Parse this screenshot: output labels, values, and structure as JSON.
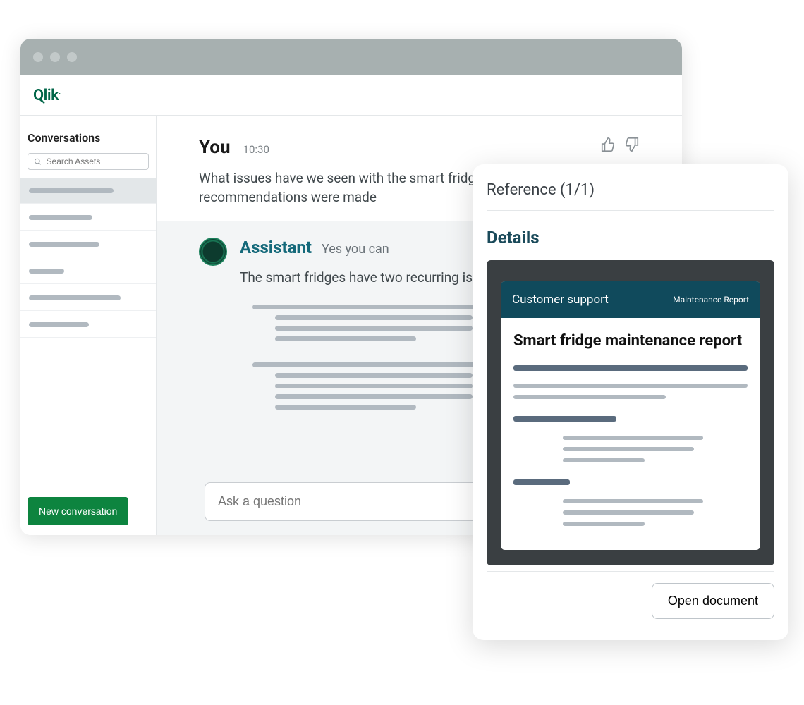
{
  "brand": "Qlik",
  "sidebar": {
    "title": "Conversations",
    "search_placeholder": "Search Assets",
    "new_conversation_label": "New conversation"
  },
  "feedback": {
    "thumbs_up": "thumbs-up",
    "thumbs_down": "thumbs-down"
  },
  "user_message": {
    "sender": "You",
    "time": "10:30",
    "text": "What issues have we seen with the smart fridges and what recommendations were made"
  },
  "assistant_message": {
    "sender": "Assistant",
    "subtitle": "Yes you can",
    "text": "The smart fridges have two recurring issues:"
  },
  "ask": {
    "placeholder": "Ask a question"
  },
  "reference_panel": {
    "heading": "Reference (1/1)",
    "details_label": "Details",
    "doc_category": "Customer support",
    "doc_tag": "Maintenance Report",
    "doc_title": "Smart fridge maintenance report",
    "open_label": "Open document"
  }
}
